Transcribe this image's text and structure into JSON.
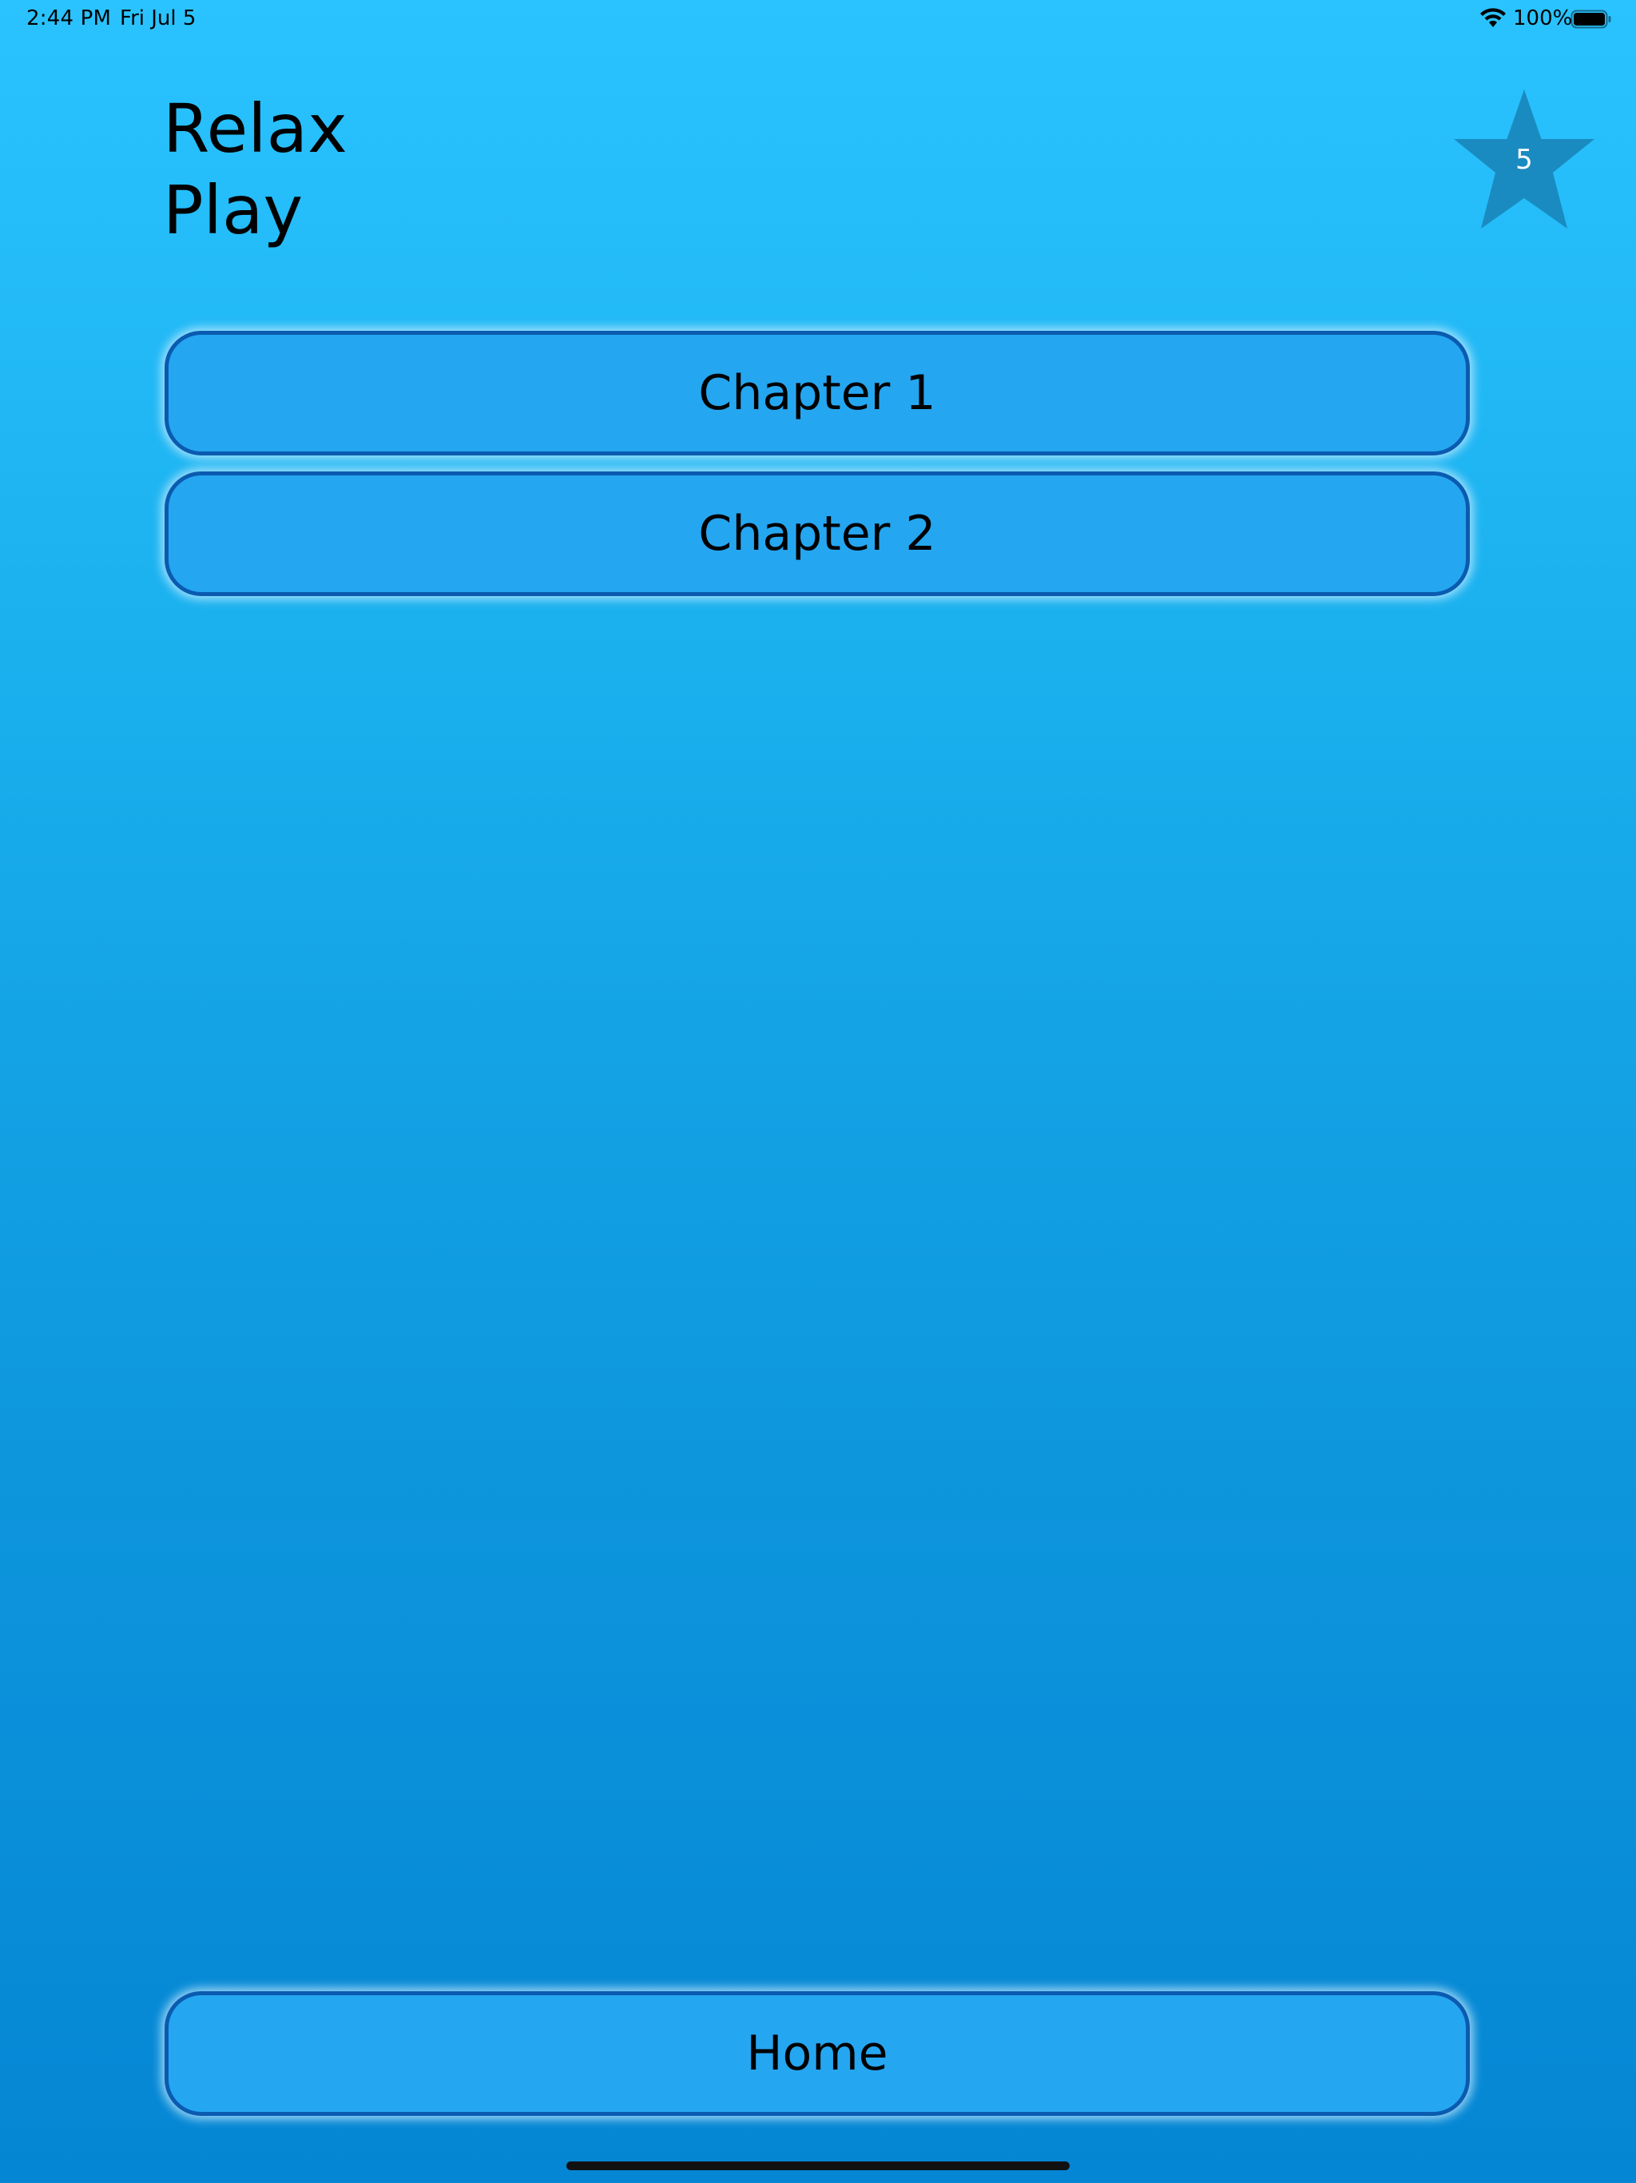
{
  "status_bar": {
    "time": "2:44 PM",
    "date": "Fri Jul 5",
    "battery_percent": "100%",
    "wifi_icon": "wifi-icon",
    "battery_icon": "battery-full-icon"
  },
  "header": {
    "title_line1": "Relax",
    "title_line2": "Play"
  },
  "star_badge": {
    "icon": "star-icon",
    "count": "5",
    "color": "#1a8bc0"
  },
  "menu": {
    "chapters": [
      {
        "label": "Chapter 1"
      },
      {
        "label": "Chapter 2"
      }
    ],
    "home_label": "Home"
  },
  "colors": {
    "background_top": "#2ac3ff",
    "background_bottom": "#0586d4",
    "button_fill": "#25a6f1",
    "button_border": "#0a5bb0"
  }
}
